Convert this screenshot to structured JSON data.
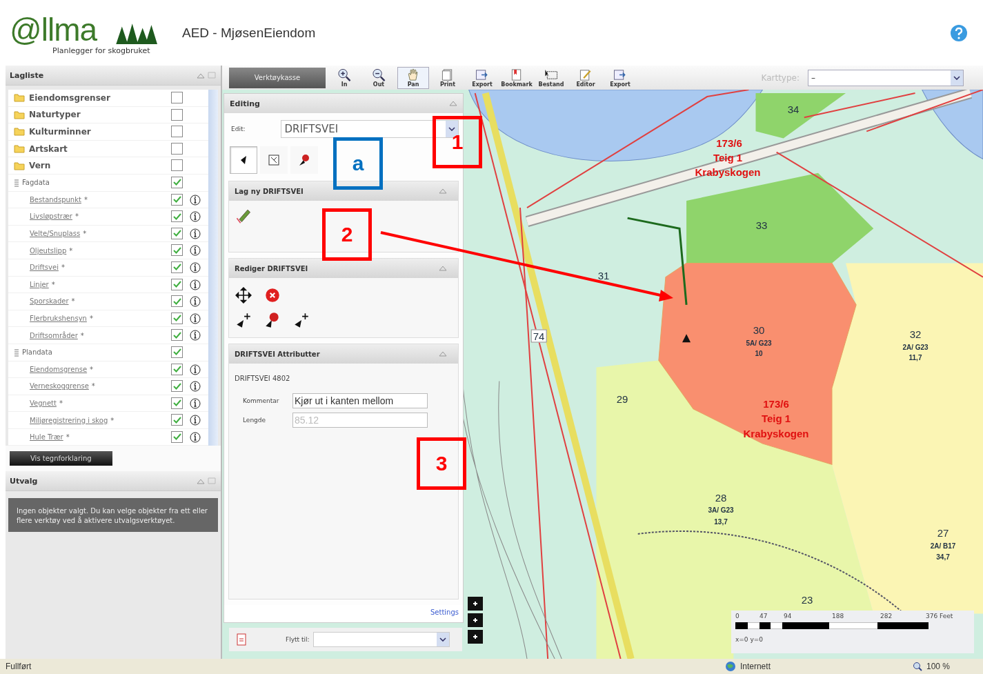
{
  "header": {
    "logo": "@llma",
    "tagline": "Planlegger for skogbruket",
    "title": "AED - MjøsenEiendom"
  },
  "layer_panel": {
    "title": "Lagliste",
    "layers": [
      {
        "label": "Eiendomsgrenser",
        "kind": "folder",
        "checked": false
      },
      {
        "label": "Naturtyper",
        "kind": "folder",
        "checked": false
      },
      {
        "label": "Kulturminner",
        "kind": "folder",
        "checked": false
      },
      {
        "label": "Artskart",
        "kind": "folder",
        "checked": false
      },
      {
        "label": "Vern",
        "kind": "folder",
        "checked": false
      },
      {
        "label": "Fagdata",
        "kind": "group",
        "checked": true,
        "children": [
          {
            "label": "Bestandspunkt",
            "suffix": "*",
            "checked": true
          },
          {
            "label": "Livsløpstrær",
            "suffix": "*",
            "checked": true
          },
          {
            "label": "Velte/Snuplass",
            "suffix": "*",
            "checked": true
          },
          {
            "label": "Oljeutslipp",
            "suffix": "*",
            "checked": true
          },
          {
            "label": "Driftsvei",
            "suffix": "*",
            "checked": true
          },
          {
            "label": "Linjer",
            "suffix": "*",
            "checked": true
          },
          {
            "label": "Sporskader",
            "suffix": "*",
            "checked": true
          },
          {
            "label": "Flerbrukshensyn",
            "suffix": "*",
            "checked": true
          },
          {
            "label": "Driftsområder",
            "suffix": "*",
            "checked": true
          }
        ]
      },
      {
        "label": "Plandata",
        "kind": "group",
        "checked": true,
        "children": [
          {
            "label": "Eiendomsgrense",
            "suffix": "*",
            "checked": true
          },
          {
            "label": "Verneskoggrense",
            "suffix": "*",
            "checked": true
          },
          {
            "label": "Vegnett",
            "suffix": "*",
            "checked": true
          },
          {
            "label": "Miljøregistrering i skog",
            "suffix": "*",
            "checked": true
          },
          {
            "label": "Hule Trær",
            "suffix": "*",
            "checked": true
          }
        ]
      }
    ],
    "legend_button": "Vis tegnforklaring"
  },
  "selection_panel": {
    "title": "Utvalg",
    "message": "Ingen objekter valgt. Du kan velge objekter fra ett eller flere verktøy ved å aktivere utvalgsverktøyet."
  },
  "toolbar": {
    "toolbox": "Verktøykasse",
    "tools": [
      {
        "label": "In",
        "kind": "zoom-in",
        "selected": false
      },
      {
        "label": "Out",
        "kind": "zoom-out",
        "selected": false
      },
      {
        "label": "Pan",
        "kind": "pan",
        "selected": true
      },
      {
        "label": "Print",
        "kind": "print",
        "selected": false
      },
      {
        "label": "Export",
        "kind": "export",
        "selected": false
      },
      {
        "label": "Bookmark",
        "kind": "bookmark",
        "selected": false
      },
      {
        "label": "Bestand",
        "kind": "select",
        "selected": false
      },
      {
        "label": "Editor",
        "kind": "editor",
        "selected": false
      },
      {
        "label": "Export",
        "kind": "export",
        "selected": false
      }
    ],
    "map_type_label": "Karttype:",
    "map_type_value": "–"
  },
  "editing": {
    "title": "Editing",
    "edit_label": "Edit:",
    "edit_value": "DRIFTSVEI",
    "modes": [
      {
        "kind": "pointer",
        "selected": true
      },
      {
        "kind": "box",
        "selected": false
      },
      {
        "kind": "delete-pin",
        "selected": false
      }
    ],
    "create_title": "Lag ny DRIFTSVEI",
    "modify_title": "Rediger DRIFTSVEI",
    "attributes_title": "DRIFTSVEI Attributter",
    "feature_name": "DRIFTSVEI 4802",
    "fields": [
      {
        "label": "Kommentar",
        "value": "Kjør ut i kanten mellom",
        "disabled": false
      },
      {
        "label": "Lengde",
        "value": "85.12",
        "disabled": true
      }
    ],
    "settings_link": "Settings",
    "move_label": "Flytt til:"
  },
  "map": {
    "labels": [
      "34",
      "173/6",
      "Teig 1",
      "Krabyskogen",
      "33",
      "31",
      "30",
      "5A/ G23",
      "10",
      "32",
      "2A/ G23",
      "11,7",
      "29",
      "173/6",
      "Teig 1",
      "Krabyskogen",
      "28",
      "3A/ G23",
      "13,7",
      "27",
      "2A/ B17",
      "34,7",
      "23",
      "74"
    ],
    "scale": {
      "ticks": [
        "0",
        "47",
        "94",
        "188",
        "282",
        "376 Feet"
      ],
      "coords": "x=0 y=0"
    }
  },
  "annotations": [
    {
      "label": "1",
      "color": "#ff0000"
    },
    {
      "label": "a",
      "color": "#0070c0"
    },
    {
      "label": "2",
      "color": "#ff0000"
    },
    {
      "label": "3",
      "color": "#ff0000"
    }
  ],
  "status_bar": {
    "status": "Fullført",
    "zone": "Internett",
    "zoom": "100 %"
  }
}
